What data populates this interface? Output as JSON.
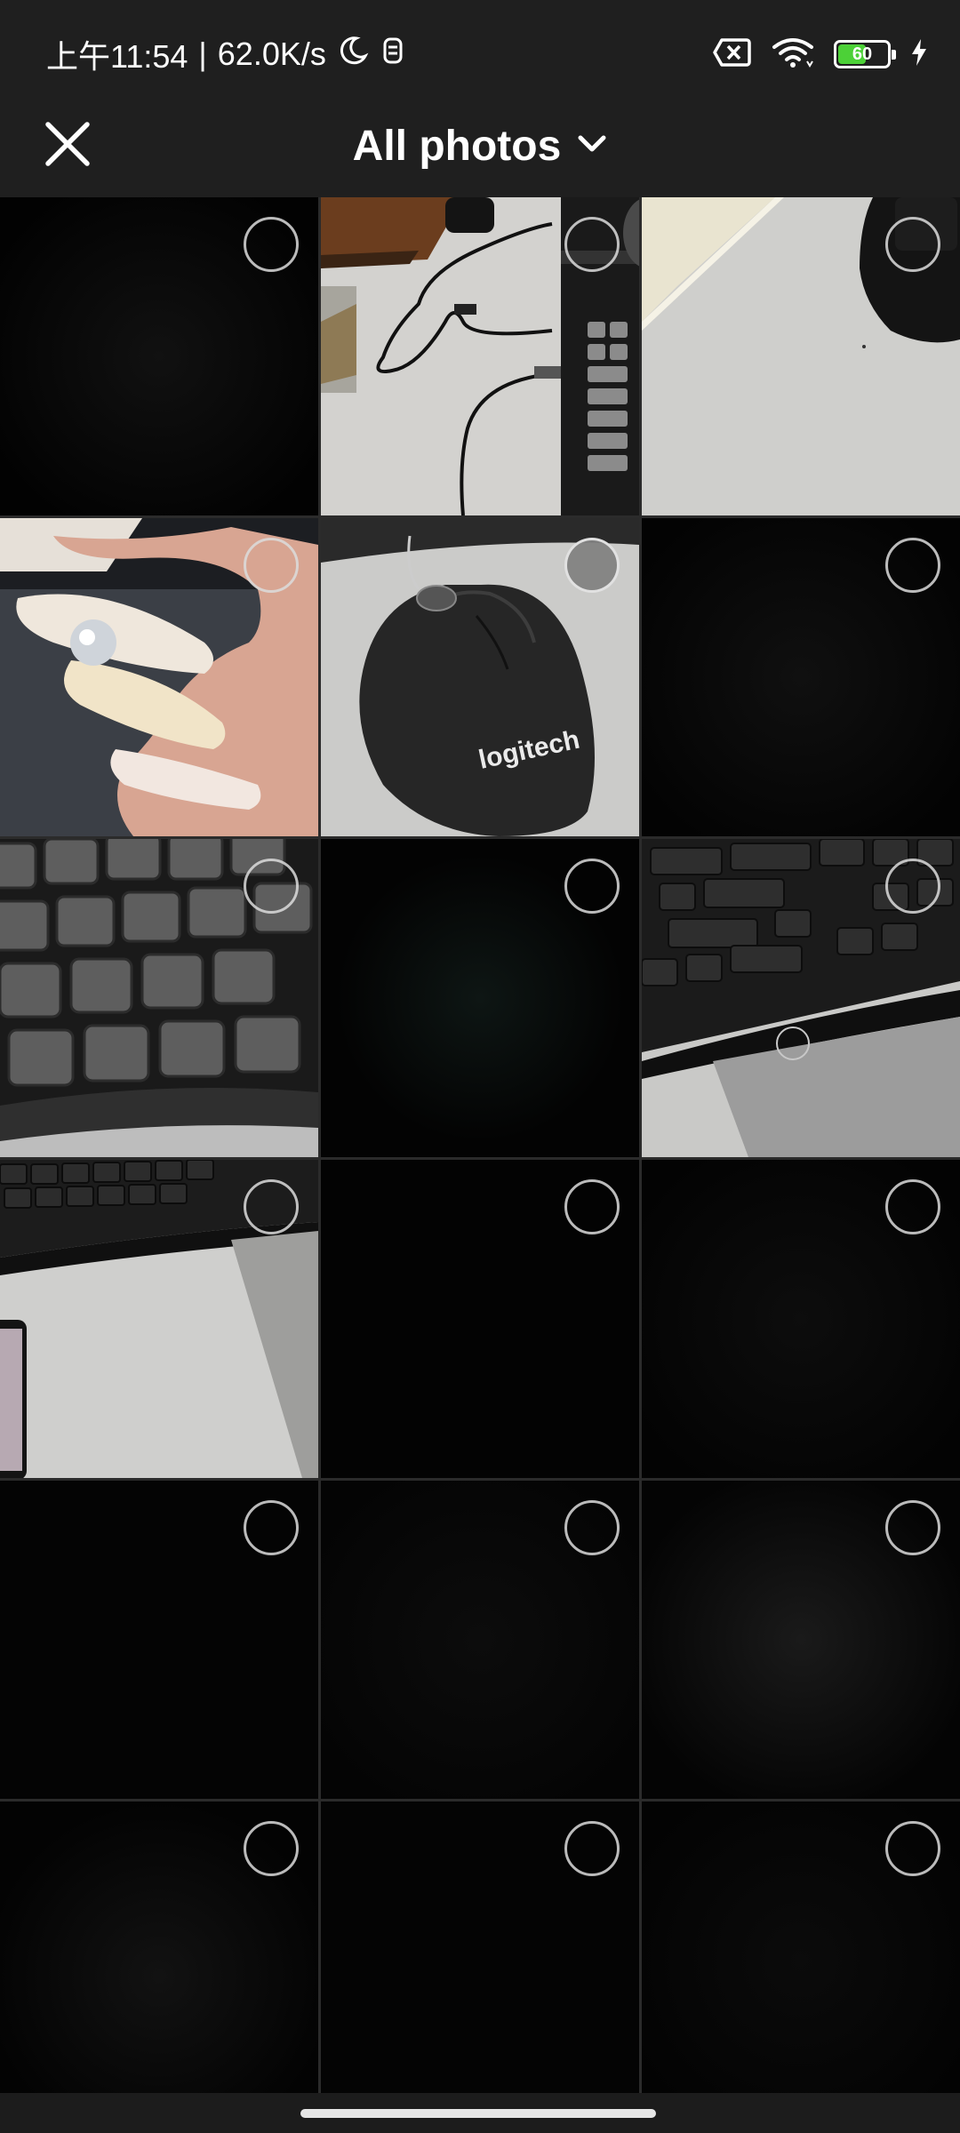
{
  "status_bar": {
    "time": "上午11:54",
    "separator": "|",
    "network_speed": "62.0K/s",
    "battery_level": "60",
    "battery_color": "#4cd137",
    "icons": [
      "moon-icon",
      "notification-icon",
      "sim-error-icon",
      "wifi-icon",
      "battery-icon",
      "charging-bolt-icon"
    ]
  },
  "header": {
    "title": "All photos",
    "close_icon": "close-icon",
    "dropdown_icon": "chevron-down-icon"
  },
  "grid": {
    "columns": 3,
    "tiles": [
      {
        "content": "dark-photo",
        "selected": false
      },
      {
        "content": "desk-cables-keyboard-photo",
        "selected": false
      },
      {
        "content": "desk-keyboard-corner-photo",
        "selected": false
      },
      {
        "content": "nails-hand-photo",
        "selected": false
      },
      {
        "content": "logitech-mouse-photo",
        "selected": true,
        "brand_text": "logitech"
      },
      {
        "content": "dark-photo",
        "selected": false
      },
      {
        "content": "keyboard-keys-closeup-photo",
        "selected": false
      },
      {
        "content": "dark-photo",
        "selected": false
      },
      {
        "content": "keyboard-enter-shift-photo",
        "selected": false
      },
      {
        "content": "keyboard-desk-phone-photo",
        "selected": false
      },
      {
        "content": "dark-photo",
        "selected": false
      },
      {
        "content": "dark-photo",
        "selected": false
      },
      {
        "content": "dark-photo",
        "selected": false
      },
      {
        "content": "dark-photo",
        "selected": false
      },
      {
        "content": "dark-photo",
        "selected": false
      },
      {
        "content": "dark-photo",
        "selected": false
      },
      {
        "content": "dark-photo",
        "selected": false
      },
      {
        "content": "dark-photo",
        "selected": false
      }
    ]
  }
}
